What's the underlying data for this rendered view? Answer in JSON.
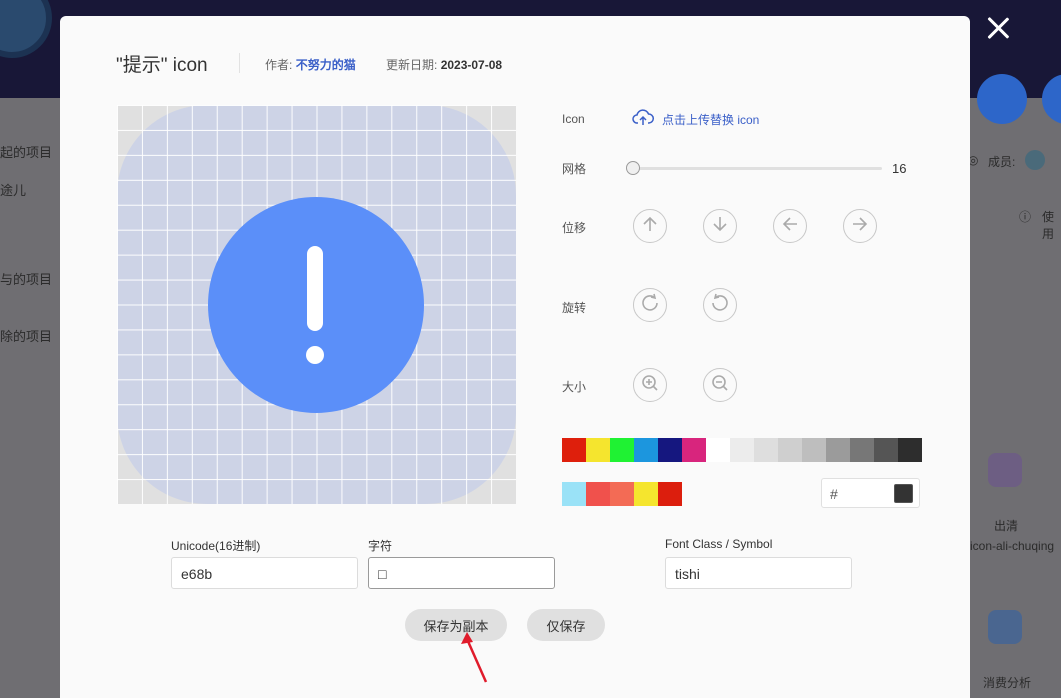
{
  "background": {
    "sidebar_items": [
      "起的项目",
      "途儿",
      "与的项目",
      "除的项目"
    ],
    "member_label": "成员:",
    "use_label": "使用",
    "cards": [
      {
        "title": "出清",
        "subtitle": "icon-ali-chuqing"
      },
      {
        "title": "消费分析"
      }
    ]
  },
  "modal": {
    "title": "\"提示\" icon",
    "author_label": "作者:",
    "author_name": "不努力的猫",
    "date_label": "更新日期:",
    "date_value": "2023-07-08"
  },
  "editor": {
    "icon_label": "Icon",
    "upload_text": "点击上传替换 icon",
    "grid_label": "网格",
    "grid_value": "16",
    "move_label": "位移",
    "rotate_label": "旋转",
    "size_label": "大小",
    "hex_prefix": "#",
    "icon_fill_color": "#5b8ff9",
    "palette_row1": [
      "#de1f0c",
      "#f5e52e",
      "#1ff233",
      "#1c96de",
      "#15177f",
      "#d8257d",
      "#ffffff",
      "#ececec",
      "#dedede",
      "#cfcfcf",
      "#bebebe",
      "#9b9b9b",
      "#777777",
      "#555555",
      "#2d2d2d"
    ],
    "palette_row2": [
      "#9ae2f7",
      "#f0514c",
      "#f36b55",
      "#f5e52e",
      "#dc1e0d"
    ],
    "current_color": "#333333"
  },
  "form": {
    "unicode_label": "Unicode(16进制)",
    "unicode_value": "e68b",
    "char_label": "字符",
    "char_value": "□",
    "fontclass_label": "Font Class / Symbol",
    "fontclass_value": "tishi"
  },
  "buttons": {
    "save_copy": "保存为副本",
    "save_only": "仅保存"
  }
}
